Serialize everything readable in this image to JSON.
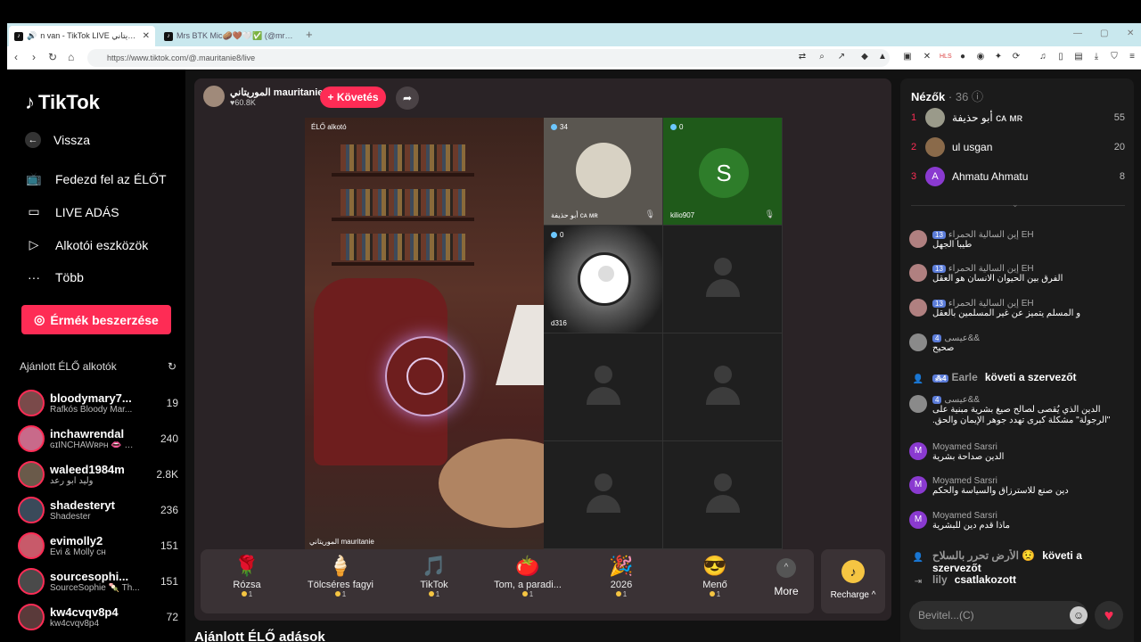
{
  "browser": {
    "tabs": [
      {
        "title": "n van - TikTok LIVE الموريتاني",
        "active": true
      },
      {
        "title": "Mrs BTK Mic🥔🤎🤍✅ (@mrsbtk) É",
        "active": false
      }
    ],
    "url": "https://www.tiktok.com/@.mauritanie8/live"
  },
  "sidebar": {
    "logo": "TikTok",
    "back": "Vissza",
    "nav": [
      {
        "label": "Fedezd fel az ÉLŐT",
        "icon": "tv-icon"
      },
      {
        "label": "LIVE ADÁS",
        "icon": "camera-icon"
      },
      {
        "label": "Alkotói eszközök",
        "icon": "creator-tools-icon"
      },
      {
        "label": "Több",
        "icon": "more-icon"
      }
    ],
    "coins_button": "Érmék beszerzése",
    "recommended_title": "Ajánlott ÉLŐ alkotók",
    "creators": [
      {
        "name": "bloodymary7...",
        "sub": "Rafkós Bloody Mar...",
        "count": "19",
        "color": "#7a4a4a"
      },
      {
        "name": "inchawrendal",
        "sub": "ɢɪINCHAWʀᴘʜ 👄 👄 ...",
        "count": "240",
        "color": "#c86a8a"
      },
      {
        "name": "waleed1984m",
        "sub": "وليد ابو رعد",
        "count": "2.8K",
        "color": "#6a5a4a"
      },
      {
        "name": "shadesteryt",
        "sub": "Shadester",
        "count": "236",
        "color": "#3a4a5a"
      },
      {
        "name": "evimolly2",
        "sub": "Évi & Molly ᴄʜ",
        "count": "151",
        "color": "#c85a6a"
      },
      {
        "name": "sourcesophi...",
        "sub": "SourceSophie 🍡 Th...",
        "count": "151",
        "color": "#4a4a4a"
      },
      {
        "name": "kw4cvqv8p4",
        "sub": "kw4cvqv8p4",
        "count": "72",
        "color": "#5a3a3a"
      }
    ]
  },
  "stream": {
    "host_name": "الموريتاني mauritanie",
    "host_likes": "60.8K",
    "follow_label": "+ Követés",
    "video_label": "ÉLŐ alkotó",
    "video_host": "الموريتاني mauritanie",
    "guests": [
      {
        "count": "34",
        "name": "أبو حذيفة ᴄᴀ ᴍʀ",
        "type": "photo"
      },
      {
        "count": "0",
        "name": "kilio907",
        "type": "letter",
        "letter": "S"
      },
      {
        "count": "0",
        "name": "d316",
        "type": "avatar"
      },
      {
        "type": "empty"
      },
      {
        "type": "empty"
      },
      {
        "type": "empty"
      },
      {
        "type": "empty"
      },
      {
        "type": "empty"
      }
    ],
    "gifts": [
      {
        "name": "Rózsa",
        "price": "1",
        "icon": "🌹"
      },
      {
        "name": "Tölcséres fagyi",
        "price": "1",
        "icon": "🍦"
      },
      {
        "name": "TikTok",
        "price": "1",
        "icon": "🎵"
      },
      {
        "name": "Tom, a paradi...",
        "price": "1",
        "icon": "🍅"
      },
      {
        "name": "2026",
        "price": "1",
        "icon": "🎉"
      },
      {
        "name": "Menő",
        "price": "1",
        "icon": "😎"
      }
    ],
    "more_label": "More",
    "recharge_label": "Recharge ^"
  },
  "recommended_live_title": "Ajánlott ÉLŐ adások",
  "viewers": {
    "title": "Nézők",
    "count": "· 36",
    "list": [
      {
        "rank": "1",
        "name": "أبو حذيفة ᴄᴀ ᴍʀ",
        "score": "55",
        "color": "#9a9a8a",
        "letter": ""
      },
      {
        "rank": "2",
        "name": "ul usgan",
        "score": "20",
        "color": "#8a6a4a",
        "letter": ""
      },
      {
        "rank": "3",
        "name": "Ahmatu Ahmatu",
        "score": "8",
        "color": "#8a3ad0",
        "letter": "A"
      }
    ]
  },
  "chat": [
    {
      "user": "إين السالية الحمراء EH",
      "lvl": "13",
      "msg": "طيبا الجهل",
      "color": "#b08080"
    },
    {
      "user": "إين السالية الحمراء EH",
      "lvl": "13",
      "msg": "الفرق بين الحيوان الانسان هو العقل",
      "color": "#b08080"
    },
    {
      "user": "إين السالية الحمراء EH",
      "lvl": "13",
      "msg": "و المسلم يتميز عن غير المسلمين بالعقل",
      "color": "#b08080"
    },
    {
      "user": "عيسى&&",
      "lvl": "4",
      "msg": "صحيح",
      "color": "#8a8a8a"
    },
    {
      "user": "Earle",
      "lvl": "4",
      "msg": "követi a szervezőt",
      "system": true
    },
    {
      "user": "عيسى&&",
      "lvl": "4",
      "msg": "الدين الذي يُقصى لصالح صيغ بشرية مبنية على \"الرجولة\" مشكلة كبرى تهدد جوهر الإيمان والحق.",
      "color": "#8a8a8a"
    },
    {
      "user": "Moyamed Sarsri",
      "msg": "الدين صداحة بشرية",
      "color": "#8a3ad0",
      "letter": "M"
    },
    {
      "user": "Moyamed Sarsri",
      "msg": "دين صنع للاسترزاق والسياسة والحكم",
      "color": "#8a3ad0",
      "letter": "M"
    },
    {
      "user": "Moyamed Sarsri",
      "msg": "ماذا قدم دين للبشرية",
      "color": "#8a3ad0",
      "letter": "M"
    },
    {
      "user": "الأرض تحرر بالسلاح 😟",
      "msg": "követi a szervezőt",
      "system": true
    },
    {
      "user": "lily",
      "msg": "csatlakozott",
      "system": true,
      "join": true
    }
  ],
  "input_placeholder": "Bevitel...(C)"
}
